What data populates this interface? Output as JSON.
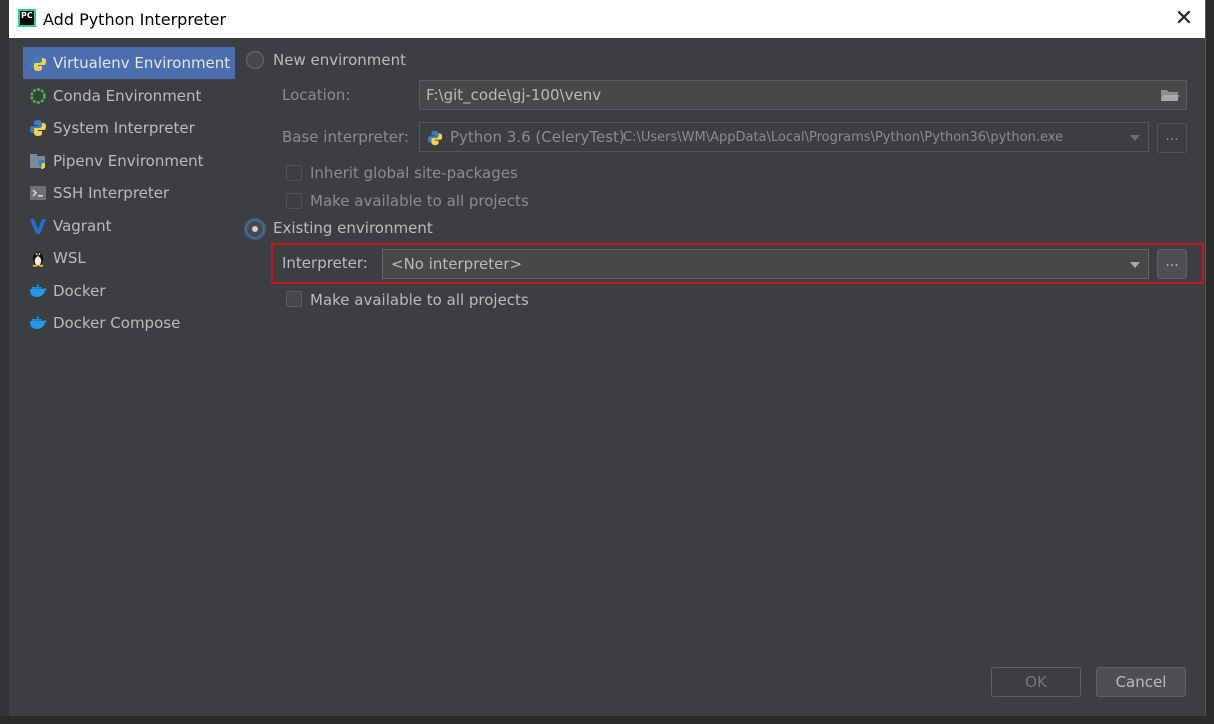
{
  "window": {
    "title": "Add Python Interpreter",
    "close_glyph": "✕",
    "app_icon_text": "PC"
  },
  "sidebar": {
    "items": [
      {
        "label": "Virtualenv Environment",
        "icon": "virtualenv-icon",
        "selected": true
      },
      {
        "label": "Conda Environment",
        "icon": "conda-icon",
        "selected": false
      },
      {
        "label": "System Interpreter",
        "icon": "python-icon",
        "selected": false
      },
      {
        "label": "Pipenv Environment",
        "icon": "pipenv-icon",
        "selected": false
      },
      {
        "label": "SSH Interpreter",
        "icon": "ssh-icon",
        "selected": false
      },
      {
        "label": "Vagrant",
        "icon": "vagrant-icon",
        "selected": false
      },
      {
        "label": "WSL",
        "icon": "linux-penguin-icon",
        "selected": false
      },
      {
        "label": "Docker",
        "icon": "docker-icon",
        "selected": false
      },
      {
        "label": "Docker Compose",
        "icon": "docker-compose-icon",
        "selected": false
      }
    ]
  },
  "new_env": {
    "radio_label": "New environment",
    "selected": false,
    "location_label": "Location:",
    "location_value": "F:\\git_code\\gj-100\\venv",
    "base_label": "Base interpreter:",
    "base_name": "Python 3.6 (CeleryTest)",
    "base_path": "C:\\Users\\WM\\AppData\\Local\\Programs\\Python\\Python36\\python.exe",
    "inherit_label": "Inherit global site-packages",
    "make_available_label": "Make available to all projects",
    "dots": "..."
  },
  "existing_env": {
    "radio_label": "Existing environment",
    "selected": true,
    "interpreter_label": "Interpreter:",
    "interpreter_value": "<No interpreter>",
    "make_available_label": "Make available to all projects",
    "dots": "..."
  },
  "buttons": {
    "ok": "OK",
    "cancel": "Cancel"
  },
  "colors": {
    "selection": "#4b6eaf",
    "highlight_border": "#c8141a",
    "background": "#3c3f41"
  }
}
